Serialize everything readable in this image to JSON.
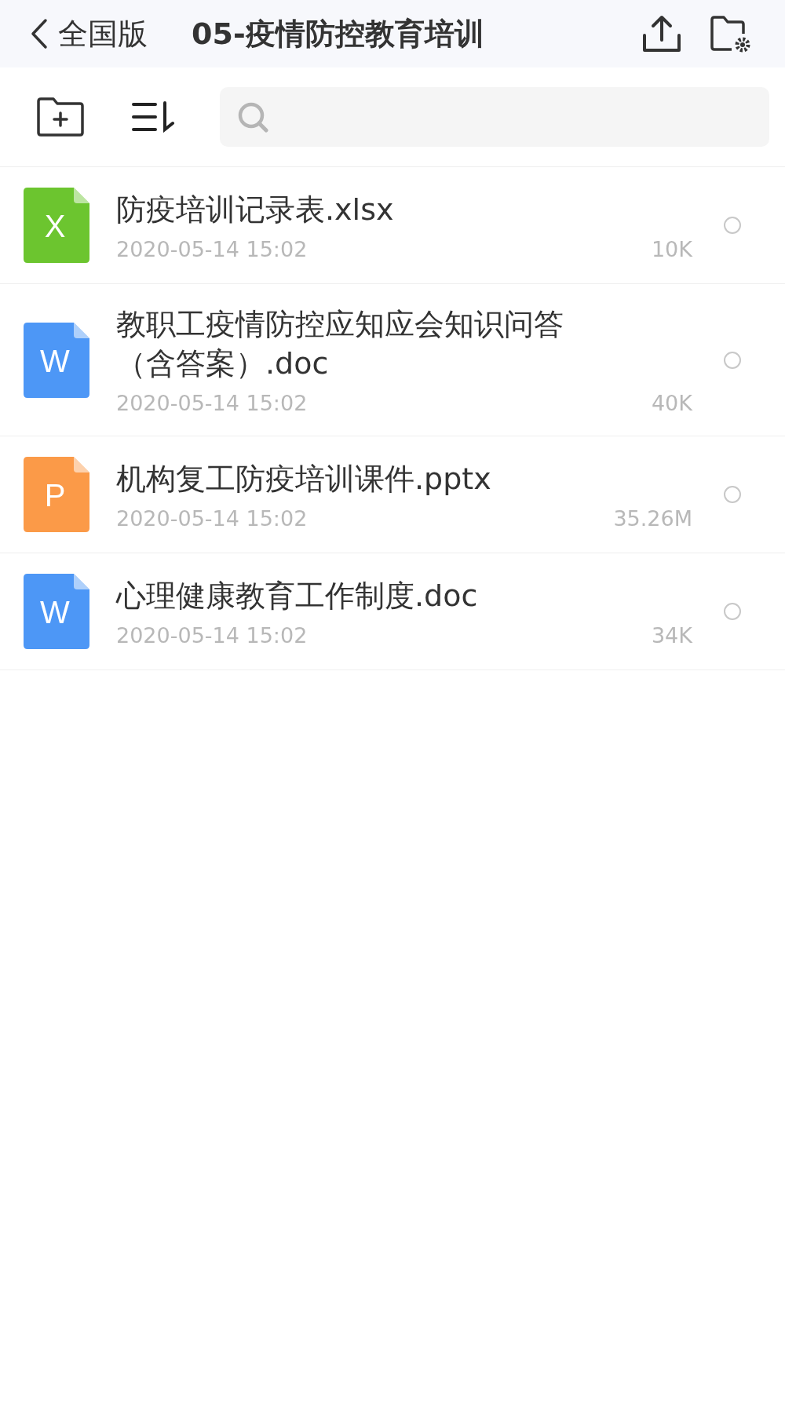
{
  "header": {
    "back_label": "全国版",
    "title": "05-疫情防控教育培训"
  },
  "files": [
    {
      "kind": "xlsx",
      "badge": "X",
      "name": "防疫培训记录表.xlsx",
      "date": "2020-05-14 15:02",
      "size": "10K",
      "selected": false
    },
    {
      "kind": "doc",
      "badge": "W",
      "name": "教职工疫情防控应知应会知识问答（含答案）.doc",
      "date": "2020-05-14 15:02",
      "size": "40K",
      "selected": false
    },
    {
      "kind": "pptx",
      "badge": "P",
      "name": "机构复工防疫培训课件.pptx",
      "date": "2020-05-14 15:02",
      "size": "35.26M",
      "selected": false
    },
    {
      "kind": "doc",
      "badge": "W",
      "name": "心理健康教育工作制度.doc",
      "date": "2020-05-14 15:02",
      "size": "34K",
      "selected": false
    }
  ]
}
